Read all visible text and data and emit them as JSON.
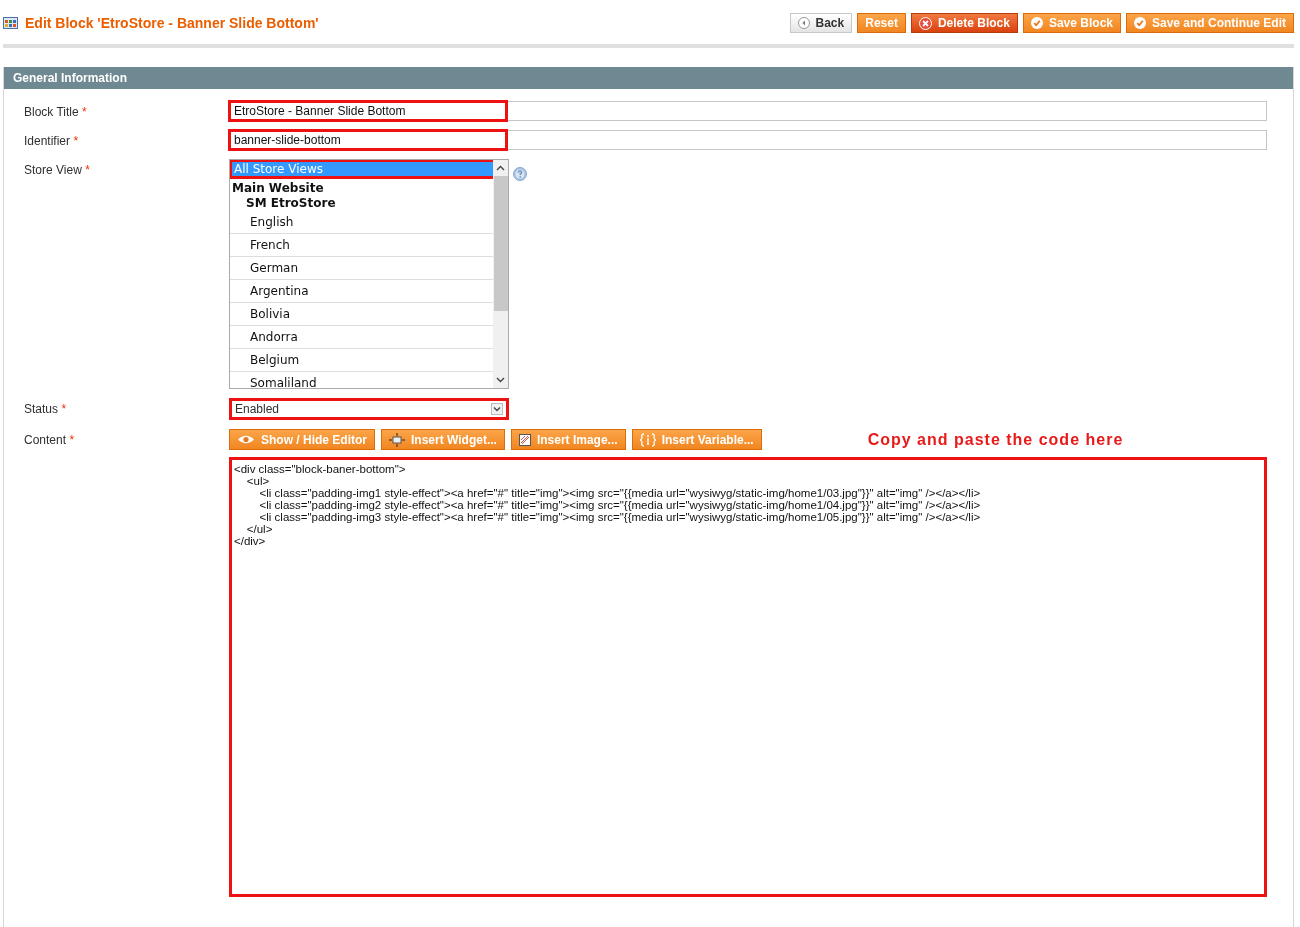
{
  "page": {
    "title": "Edit Block 'EtroStore - Banner Slide Bottom'"
  },
  "actions": [
    {
      "label": "Back",
      "kind": "back"
    },
    {
      "label": "Reset",
      "kind": "reset"
    },
    {
      "label": "Delete Block",
      "kind": "delete"
    },
    {
      "label": "Save Block",
      "kind": "save"
    },
    {
      "label": "Save and Continue Edit",
      "kind": "save"
    }
  ],
  "section": {
    "title": "General Information"
  },
  "fields": [
    {
      "kind": "text",
      "label": "Block Title",
      "required_mark": "*",
      "value": "EtroStore - Banner Slide Bottom",
      "highlighted": true
    },
    {
      "kind": "text",
      "label": "Identifier",
      "required_mark": "*",
      "value": "banner-slide-bottom",
      "highlighted": true
    },
    {
      "kind": "multiselect",
      "label": "Store View",
      "required_mark": "*",
      "highlighted": true,
      "options": [
        {
          "label": "All Store Views",
          "selected": true
        },
        {
          "label": "Main Website",
          "children": [
            {
              "label": "SM EtroStore",
              "children": [
                {
                  "label": "English",
                  "selected": false
                },
                {
                  "label": "French",
                  "selected": false
                },
                {
                  "label": "German",
                  "selected": false
                },
                {
                  "label": "Argentina",
                  "selected": false
                },
                {
                  "label": "Bolivia",
                  "selected": false
                },
                {
                  "label": "Andorra",
                  "selected": false
                },
                {
                  "label": "Belgium",
                  "selected": false
                },
                {
                  "label": "Somaliland",
                  "selected": false
                }
              ]
            }
          ]
        }
      ]
    },
    {
      "kind": "select",
      "label": "Status",
      "required_mark": "*",
      "value": "Enabled",
      "highlighted": true
    },
    {
      "kind": "editor",
      "label": "Content",
      "required_mark": "*",
      "highlighted": true,
      "buttons": [
        {
          "label": "Show / Hide Editor",
          "kind": "toggle"
        },
        {
          "label": "Insert Widget...",
          "kind": "widget"
        },
        {
          "label": "Insert Image...",
          "kind": "image"
        },
        {
          "label": "Insert Variable...",
          "kind": "variable"
        }
      ],
      "note": "Copy and paste the code here",
      "value": "<div class=\"block-baner-bottom\">\n\t<ul>\n\t\t<li class=\"padding-img1 style-effect\"><a href=\"#\" title=\"img\"><img src=\"{{media url=\"wysiwyg/static-img/home1/03.jpg\"}}\" alt=\"img\" /></a></li>\n\t\t<li class=\"padding-img2 style-effect\"><a href=\"#\" title=\"img\"><img src=\"{{media url=\"wysiwyg/static-img/home1/04.jpg\"}}\" alt=\"img\" /></a></li>\n\t\t<li class=\"padding-img3 style-effect\"><a href=\"#\" title=\"img\"><img src=\"{{media url=\"wysiwyg/static-img/home1/05.jpg\"}}\" alt=\"img\" /></a></li>\n\t</ul>\n</div>"
    }
  ]
}
